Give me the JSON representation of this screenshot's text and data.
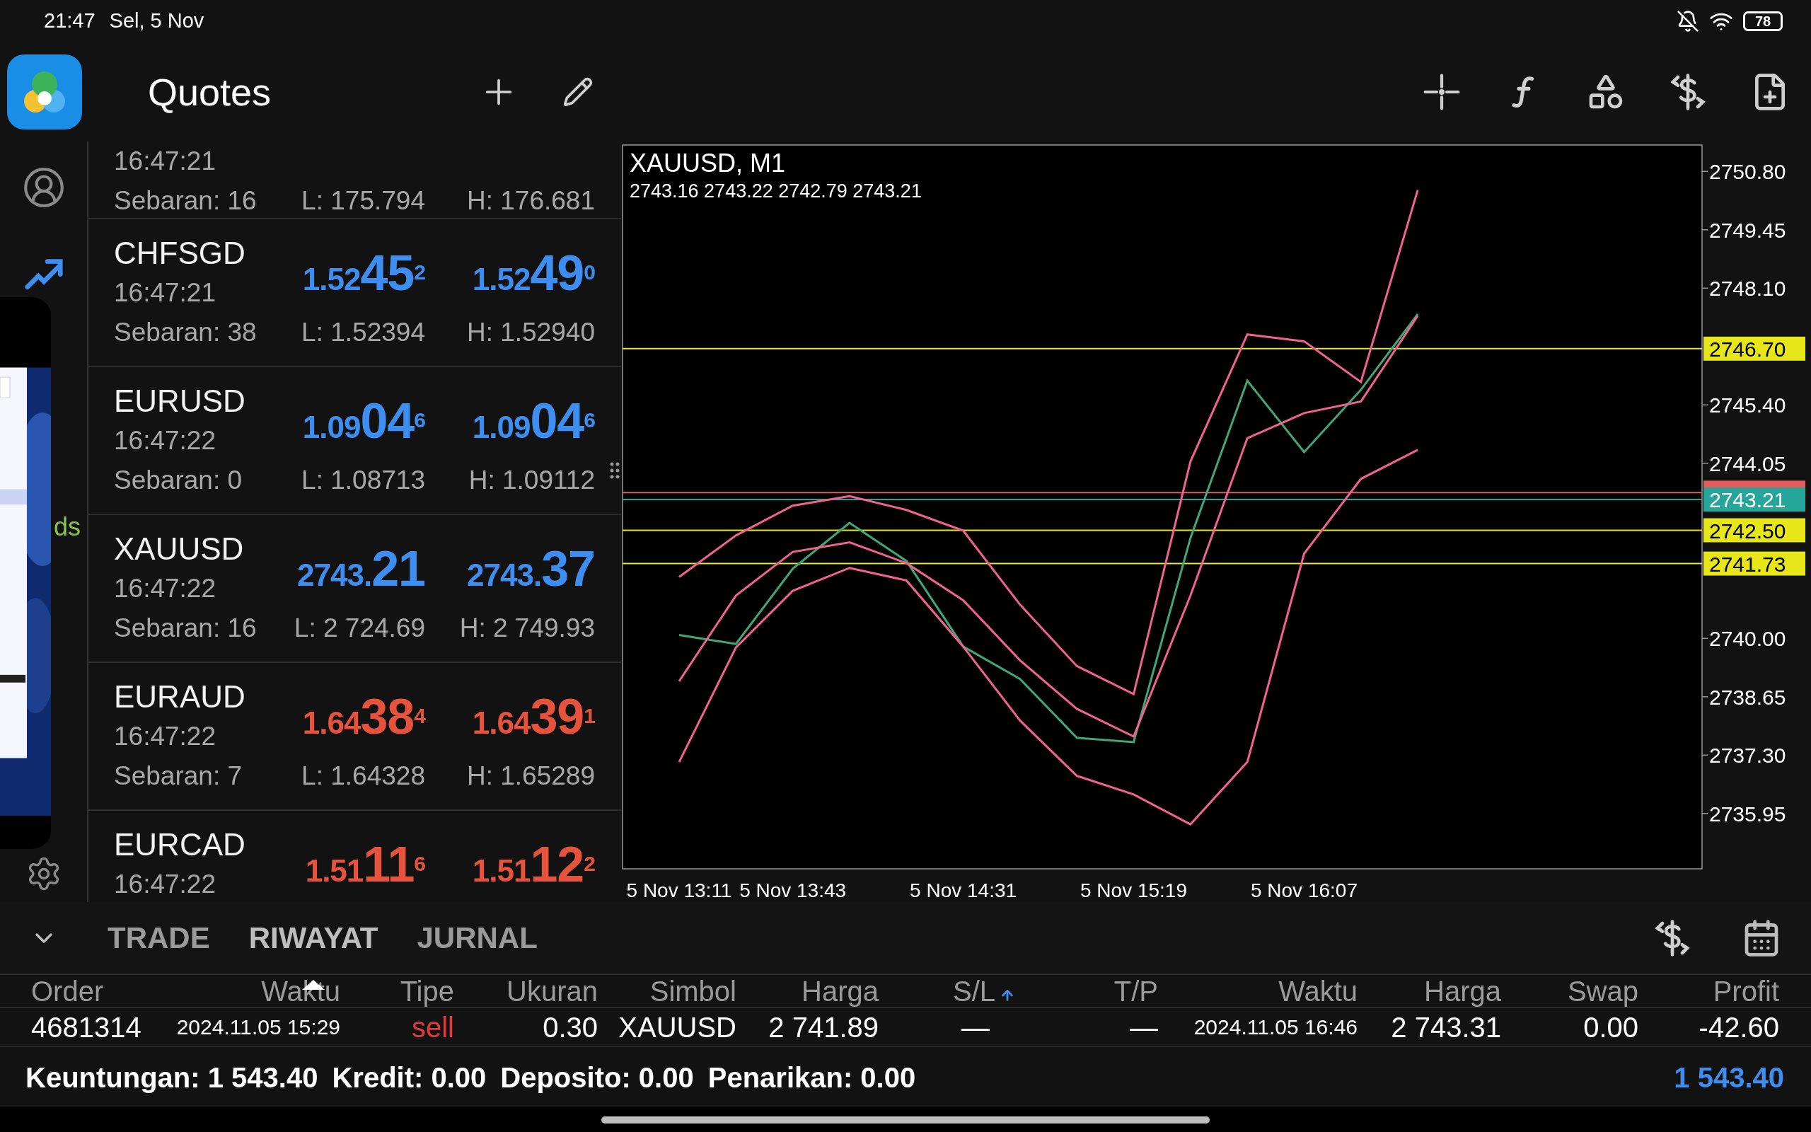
{
  "status_bar": {
    "time": "21:47",
    "date": "Sel, 5 Nov",
    "battery": "78"
  },
  "toolbar": {
    "title": "Quotes"
  },
  "sidebar": {
    "items": [
      {
        "selected": false
      },
      {
        "selected": true
      },
      {
        "selected": false,
        "label": "ds"
      },
      {
        "selected": false
      }
    ]
  },
  "quotes": {
    "rows": [
      {
        "time": "16:47:21",
        "spread": "Sebaran: 16",
        "low": "L: 175.794",
        "high": "H: 176.681"
      },
      {
        "symbol": "CHFSGD",
        "time": "16:47:21",
        "color": "#3d8ef0",
        "bid": {
          "prefix": "1.52",
          "big": "45",
          "sup": "2"
        },
        "ask": {
          "prefix": "1.52",
          "big": "49",
          "sup": "0"
        },
        "spread": "Sebaran: 38",
        "low": "L: 1.52394",
        "high": "H: 1.52940"
      },
      {
        "symbol": "EURUSD",
        "time": "16:47:22",
        "color": "#3d8ef0",
        "bid": {
          "prefix": "1.09",
          "big": "04",
          "sup": "6"
        },
        "ask": {
          "prefix": "1.09",
          "big": "04",
          "sup": "6"
        },
        "spread": "Sebaran: 0",
        "low": "L: 1.08713",
        "high": "H: 1.09112"
      },
      {
        "symbol": "XAUUSD",
        "time": "16:47:22",
        "color": "#3d8ef0",
        "bid": {
          "prefix": "2743.",
          "big": "21"
        },
        "ask": {
          "prefix": "2743.",
          "big": "37"
        },
        "spread": "Sebaran: 16",
        "low": "L: 2 724.69",
        "high": "H: 2 749.93"
      },
      {
        "symbol": "EURAUD",
        "time": "16:47:22",
        "color": "#e5533d",
        "bid": {
          "prefix": "1.64",
          "big": "38",
          "sup": "4"
        },
        "ask": {
          "prefix": "1.64",
          "big": "39",
          "sup": "1"
        },
        "spread": "Sebaran: 7",
        "low": "L: 1.64328",
        "high": "H: 1.65289"
      },
      {
        "symbol": "EURCAD",
        "time": "16:47:22",
        "color": "#e5533d",
        "bid": {
          "prefix": "1.51",
          "big": "11",
          "sup": "6"
        },
        "ask": {
          "prefix": "1.51",
          "big": "12",
          "sup": "2"
        }
      }
    ]
  },
  "chart": {
    "ohlc": "2743.16 2743.22 2742.79 2743.21",
    "chart_data": {
      "type": "line",
      "title": "XAUUSD, M1",
      "categories": [
        "5 Nov 13:11",
        null,
        "5 Nov 13:43",
        null,
        null,
        "5 Nov 14:31",
        null,
        null,
        "5 Nov 15:19",
        null,
        null,
        "5 Nov 16:07",
        null,
        null
      ],
      "series": [
        {
          "color": "#3fa77a",
          "values": [
            2740.08,
            2739.87,
            2741.61,
            2742.67,
            2741.79,
            2739.81,
            2739.06,
            2737.7,
            2737.6,
            2742.32,
            2745.96,
            2744.31,
            2745.75,
            2747.5
          ]
        },
        {
          "color": "#f06292",
          "values": [
            2741.42,
            2742.38,
            2743.07,
            2743.29,
            2742.97,
            2742.49,
            2740.78,
            2739.36,
            2738.71,
            2744.09,
            2747.03,
            2746.87,
            2745.93,
            2750.37
          ]
        },
        {
          "color": "#f06292",
          "values": [
            2739.01,
            2740.99,
            2742.0,
            2742.22,
            2741.74,
            2740.88,
            2739.49,
            2738.37,
            2737.73,
            2740.99,
            2744.63,
            2745.21,
            2745.48,
            2747.46
          ]
        },
        {
          "color": "#f06292",
          "values": [
            2737.14,
            2739.79,
            2741.1,
            2741.63,
            2741.34,
            2739.81,
            2738.1,
            2736.82,
            2736.39,
            2735.7,
            2737.14,
            2741.96,
            2743.69,
            2744.36
          ]
        }
      ],
      "ylim": [
        2734.67,
        2751.41
      ],
      "yticks": [
        {
          "value": 2750.8,
          "label": "2750.80"
        },
        {
          "value": 2749.45,
          "label": "2749.45"
        },
        {
          "value": 2748.1,
          "label": "2748.10"
        },
        {
          "value": 2745.4,
          "label": "2745.40"
        },
        {
          "value": 2744.05,
          "label": "2744.05"
        },
        {
          "value": 2740,
          "label": "2740.00"
        },
        {
          "value": 2738.65,
          "label": "2738.65"
        },
        {
          "value": 2737.3,
          "label": "2737.30"
        },
        {
          "value": 2735.95,
          "label": "2735.95"
        }
      ],
      "ref_lines": [
        {
          "axis": "y",
          "value": 2746.7,
          "label": "2746.70",
          "color": "#e6e619"
        },
        {
          "axis": "y",
          "value": 2743.37,
          "color": "#e35d5d"
        },
        {
          "axis": "y",
          "value": 2743.21,
          "label": "2743.21",
          "color": "#26a69a"
        },
        {
          "axis": "y",
          "value": 2742.5,
          "label": "2742.50",
          "color": "#e6e619"
        },
        {
          "axis": "y",
          "value": 2741.73,
          "label": "2741.73",
          "color": "#e6e619"
        }
      ]
    }
  },
  "bottom": {
    "tabs": [
      {
        "label": "TRADE",
        "selected": false
      },
      {
        "label": "RIWAYAT",
        "selected": true
      },
      {
        "label": "JURNAL",
        "selected": false
      }
    ],
    "table": {
      "columns": [
        {
          "label": "Order",
          "kind": "id",
          "sorted": false
        },
        {
          "label": "Waktu",
          "kind": "datetime",
          "sorted": false
        },
        {
          "label": "Tipe",
          "kind": "side",
          "sorted": false
        },
        {
          "label": "Ukuran",
          "kind": "number",
          "sorted": false
        },
        {
          "label": "Simbol",
          "kind": "text",
          "sorted": false
        },
        {
          "label": "Harga",
          "kind": "number",
          "sorted": false
        },
        {
          "label": "S/L",
          "kind": "number",
          "sorted": true
        },
        {
          "label": "T/P",
          "kind": "number",
          "sorted": false
        },
        {
          "label": "Waktu",
          "kind": "datetime",
          "sorted": false
        },
        {
          "label": "Harga",
          "kind": "number",
          "sorted": false
        },
        {
          "label": "Swap",
          "kind": "number",
          "sorted": false
        },
        {
          "label": "Profit",
          "kind": "number",
          "sorted": false
        }
      ],
      "rows": [
        {
          "cells": [
            "4681314",
            "2024.11.05 15:29",
            "sell",
            "0.30",
            "XAUUSD",
            "2 741.89",
            "—",
            "—",
            "2024.11.05 16:46",
            "2 743.31",
            "0.00",
            "-42.60"
          ]
        }
      ]
    },
    "summary": [
      "Keuntungan: 1 543.40",
      "Kredit: 0.00",
      "Deposito: 0.00",
      "Penarikan: 0.00"
    ],
    "total": "1 543.40"
  }
}
